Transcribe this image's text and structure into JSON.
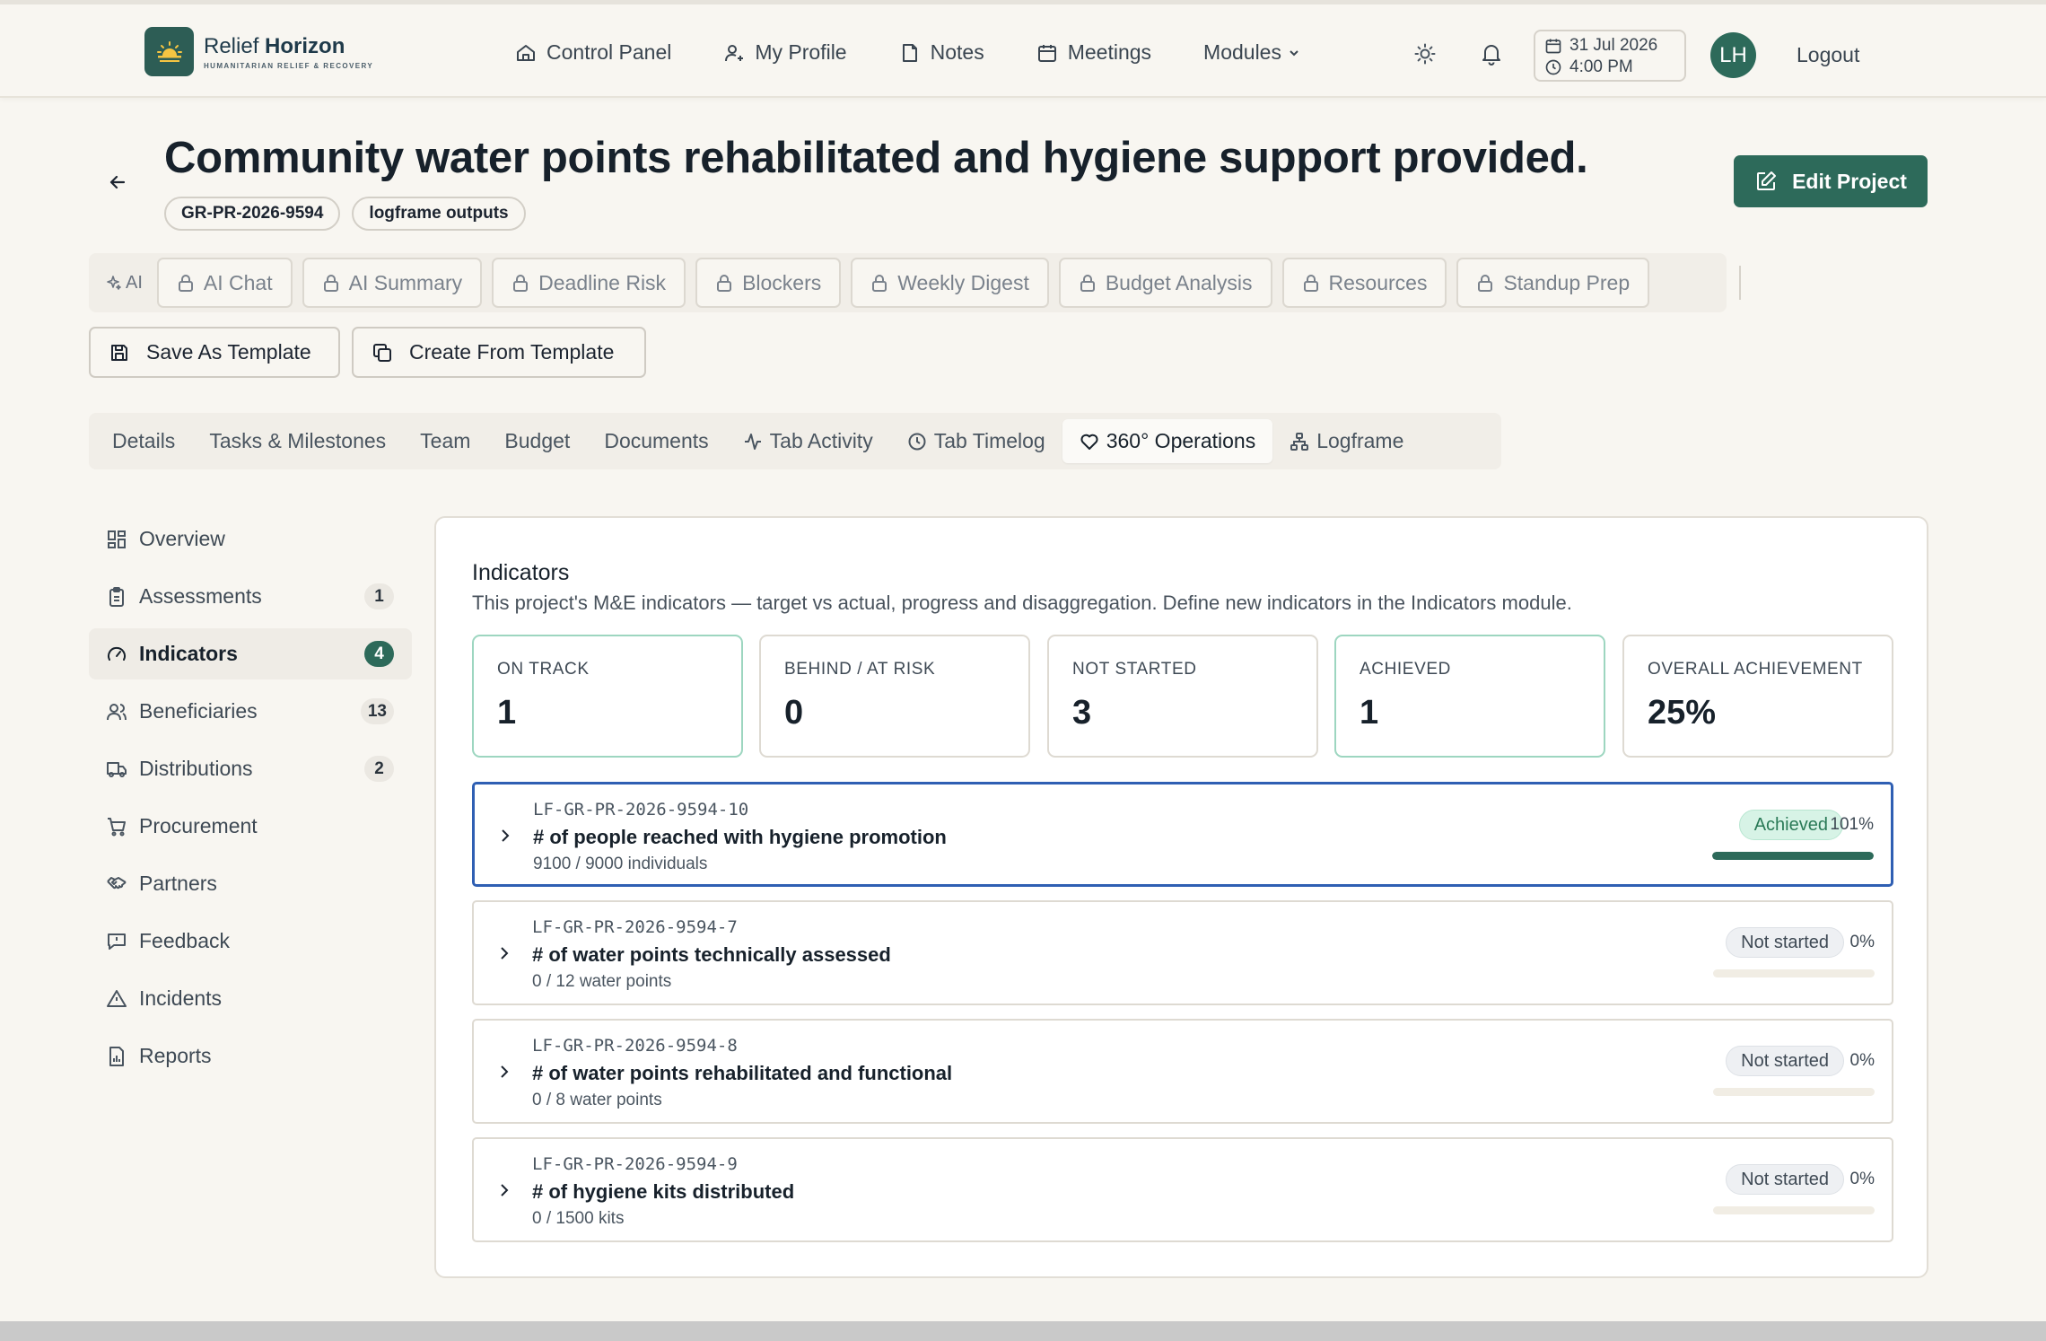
{
  "brand": {
    "name_regular": "Relief ",
    "name_bold": "Horizon",
    "tagline": "HUMANITARIAN RELIEF & RECOVERY"
  },
  "nav": {
    "items": [
      {
        "label": "Control Panel",
        "icon": "home-icon"
      },
      {
        "label": "My Profile",
        "icon": "user-icon"
      },
      {
        "label": "Notes",
        "icon": "note-icon"
      },
      {
        "label": "Meetings",
        "icon": "calendar-icon"
      }
    ],
    "modules_label": "Modules",
    "date": "31 Jul 2026",
    "time": "4:00 PM",
    "avatar_initials": "LH",
    "logout_label": "Logout"
  },
  "project": {
    "title": "Community water points rehabilitated and hygiene support provided.",
    "code": "GR-PR-2026-9594",
    "tag": "logframe outputs",
    "edit_label": "Edit Project"
  },
  "ai_toolbar": {
    "label": "AI",
    "buttons": [
      "AI Chat",
      "AI Summary",
      "Deadline Risk",
      "Blockers",
      "Weekly Digest",
      "Budget Analysis",
      "Resources",
      "Standup Prep"
    ]
  },
  "templates": {
    "save_label": "Save As Template",
    "create_label": "Create From Template"
  },
  "tabs": [
    "Details",
    "Tasks & Milestones",
    "Team",
    "Budget",
    "Documents",
    "Tab Activity",
    "Tab Timelog",
    "360° Operations",
    "Logframe"
  ],
  "active_tab": "360° Operations",
  "sidebar": {
    "items": [
      {
        "label": "Overview",
        "badge": ""
      },
      {
        "label": "Assessments",
        "badge": "1"
      },
      {
        "label": "Indicators",
        "badge": "4"
      },
      {
        "label": "Beneficiaries",
        "badge": "13"
      },
      {
        "label": "Distributions",
        "badge": "2"
      },
      {
        "label": "Procurement",
        "badge": ""
      },
      {
        "label": "Partners",
        "badge": ""
      },
      {
        "label": "Feedback",
        "badge": ""
      },
      {
        "label": "Incidents",
        "badge": ""
      },
      {
        "label": "Reports",
        "badge": ""
      }
    ]
  },
  "indicators": {
    "title": "Indicators",
    "description": "This project's M&E indicators — target vs actual, progress and disaggregation. Define new indicators in the Indicators module.",
    "stats": [
      {
        "label": "ON TRACK",
        "value": "1"
      },
      {
        "label": "BEHIND / AT RISK",
        "value": "0"
      },
      {
        "label": "NOT STARTED",
        "value": "3"
      },
      {
        "label": "ACHIEVED",
        "value": "1"
      },
      {
        "label": "OVERALL ACHIEVEMENT",
        "value": "25%"
      }
    ],
    "rows": [
      {
        "code": "LF-GR-PR-2026-9594-10",
        "name": "# of people reached with hygiene promotion",
        "meta": "9100 / 9000 individuals",
        "status": "Achieved",
        "percent": "101%",
        "progress": 1.0
      },
      {
        "code": "LF-GR-PR-2026-9594-7",
        "name": "# of water points technically assessed",
        "meta": "0 / 12 water points",
        "status": "Not started",
        "percent": "0%",
        "progress": 0
      },
      {
        "code": "LF-GR-PR-2026-9594-8",
        "name": "# of water points rehabilitated and functional",
        "meta": "0 / 8 water points",
        "status": "Not started",
        "percent": "0%",
        "progress": 0
      },
      {
        "code": "LF-GR-PR-2026-9594-9",
        "name": "# of hygiene kits distributed",
        "meta": "0 / 1500 kits",
        "status": "Not started",
        "percent": "0%",
        "progress": 0
      }
    ]
  },
  "colors": {
    "accent": "#2d6a5a",
    "selected_border": "#2f5fb3",
    "background": "#f8f6f1"
  }
}
